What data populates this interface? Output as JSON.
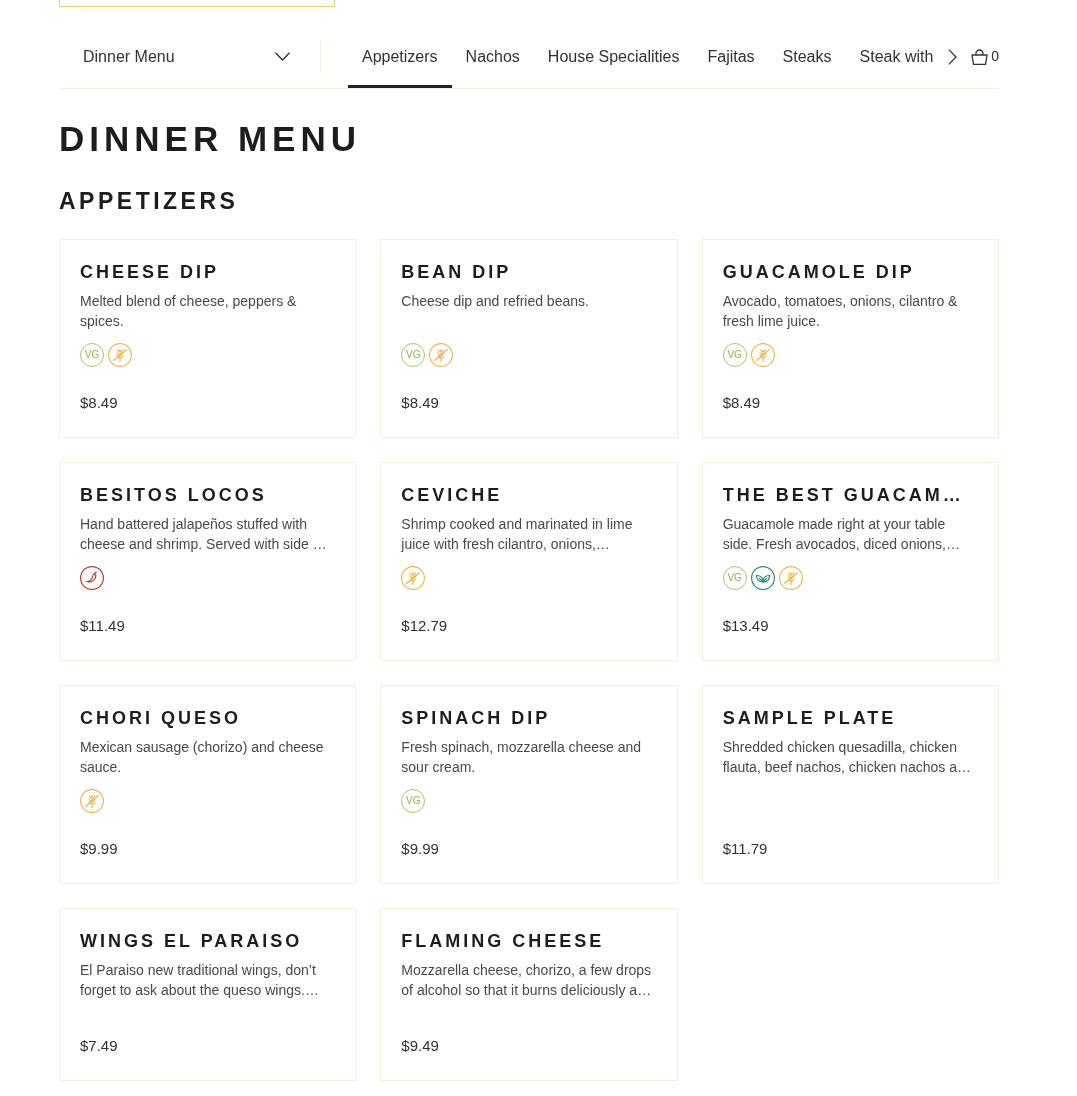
{
  "menu_selector": {
    "label": "Dinner Menu"
  },
  "tabs": [
    {
      "label": "Appetizers",
      "selected": true
    },
    {
      "label": "Nachos",
      "selected": false
    },
    {
      "label": "House Specialities",
      "selected": false
    },
    {
      "label": "Fajitas",
      "selected": false
    },
    {
      "label": "Steaks",
      "selected": false
    },
    {
      "label": "Steak with",
      "selected": false
    }
  ],
  "cart": {
    "count": "0"
  },
  "page_title": "DINNER MENU",
  "section": {
    "title": "APPETIZERS",
    "items": [
      {
        "name": "CHEESE DIP",
        "description": "Melted blend of cheese, peppers & spices.",
        "price": "$8.49",
        "tags": [
          {
            "kind": "vg",
            "label": "VG"
          },
          {
            "kind": "gluten_free"
          }
        ]
      },
      {
        "name": "BEAN DIP",
        "description": "Cheese dip and refried beans.",
        "price": "$8.49",
        "tags": [
          {
            "kind": "vg",
            "label": "VG"
          },
          {
            "kind": "gluten_free"
          }
        ]
      },
      {
        "name": "GUACAMOLE DIP",
        "description": "Avocado, tomatoes, onions, cilantro & fresh lime juice.",
        "price": "$8.49",
        "tags": [
          {
            "kind": "vg",
            "label": "VG"
          },
          {
            "kind": "gluten_free"
          }
        ]
      },
      {
        "name": "BESITOS LOCOS",
        "description": "Hand battered jalapeños stuffed with cheese and shrimp. Served with side …",
        "price": "$11.49",
        "tags": [
          {
            "kind": "spicy"
          }
        ]
      },
      {
        "name": "CEVICHE",
        "description": "Shrimp cooked and marinated in lime juice with fresh cilantro, onions,…",
        "price": "$12.79",
        "tags": [
          {
            "kind": "gluten_free"
          }
        ]
      },
      {
        "name": "THE BEST GUACAM…",
        "description": "Guacamole made right at your table side. Fresh avocados, diced onions,…",
        "price": "$13.49",
        "tags": [
          {
            "kind": "vg",
            "label": "VG"
          },
          {
            "kind": "vegan"
          },
          {
            "kind": "gluten_free"
          }
        ]
      },
      {
        "name": "CHORI QUESO",
        "description": "Mexican sausage (chorizo) and cheese sauce.",
        "price": "$9.99",
        "tags": [
          {
            "kind": "gluten_free"
          }
        ]
      },
      {
        "name": "SPINACH DIP",
        "description": "Fresh spinach, mozzarella cheese and sour cream.",
        "price": "$9.99",
        "tags": [
          {
            "kind": "vg",
            "label": "VG"
          }
        ]
      },
      {
        "name": "SAMPLE PLATE",
        "description": "Shredded chicken quesadilla, chicken flauta, beef nachos, chicken nachos a…",
        "price": "$11.79"
      },
      {
        "name": "WINGS EL PARAISO",
        "description": "El Paraiso new traditional wings, don’t forget to ask about the queso wings.…",
        "price": "$7.49"
      },
      {
        "name": "FLAMING CHEESE",
        "description": "Mozzarella cheese, chorizo, a few drops of alcohol so that it burns deliciously a…",
        "price": "$9.49"
      }
    ]
  }
}
